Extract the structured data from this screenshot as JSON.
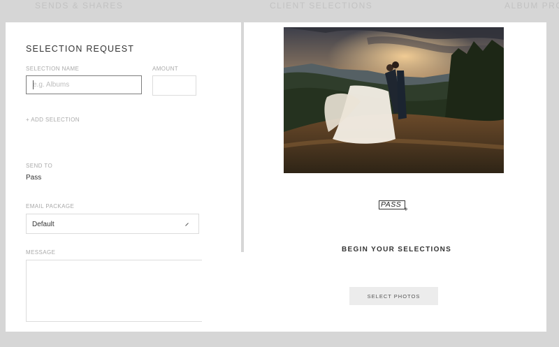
{
  "nav": {
    "items": [
      "SENDS & SHARES",
      "CLIENT SELECTIONS",
      "ALBUM PRO"
    ]
  },
  "form": {
    "title": "SELECTION REQUEST",
    "selection_name_label": "SELECTION NAME",
    "selection_name_placeholder": "e.g. Albums",
    "amount_label": "AMOUNT",
    "add_selection_label": "+ ADD SELECTION",
    "send_to_label": "SEND TO",
    "send_to_value": "Pass",
    "email_package_label": "EMAIL PACKAGE",
    "email_package_value": "Default",
    "message_label": "MESSAGE"
  },
  "preview": {
    "logo_text": "PASS",
    "logo_plus": "+",
    "heading": "BEGIN YOUR SELECTIONS",
    "button_label": "SELECT PHOTOS"
  },
  "colors": {
    "background": "#d6d6d6",
    "panel": "#ffffff",
    "button_bg": "#ececec",
    "active_border": "#7d7d7d"
  }
}
